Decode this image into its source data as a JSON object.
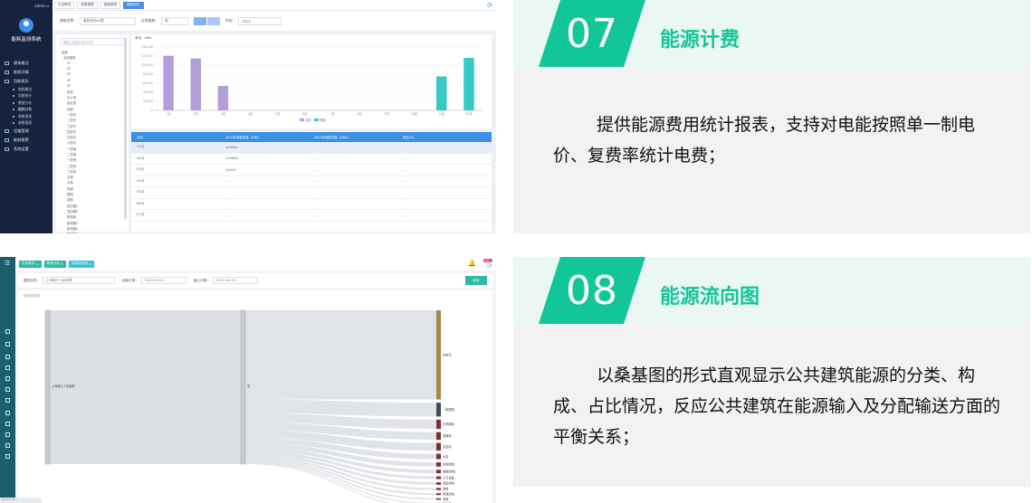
{
  "shot1": {
    "user_menu": "admin",
    "app_name": "能耗监测系统",
    "nav": [
      {
        "label": "建筑概况"
      },
      {
        "label": "能耗详情"
      },
      {
        "label": "用能报告",
        "sub": [
          "能耗概况",
          "用能统计",
          "数据分析",
          "能耗分析",
          "参数报表",
          "参数报表"
        ]
      },
      {
        "label": "设备管理"
      },
      {
        "label": "能耗报警"
      },
      {
        "label": "系统设置"
      }
    ],
    "tabs": [
      "平台概况",
      "参数报表",
      "能耗报表",
      "能耗分析"
    ],
    "filter": {
      "building_label": "建筑名称：",
      "building_value": "某科技办公楼",
      "type_label": "分类能耗：",
      "type_value": "电",
      "year_label": "年份：",
      "year_value": "2022"
    },
    "tree": {
      "search_placeholder": "请输入关键字进行过滤",
      "items": [
        "能耗",
        "全部建筑",
        "1F",
        "2F",
        "3F",
        "4F",
        "5F",
        "机房",
        "办公室",
        "会议室",
        "走廊",
        "一层东",
        "二层东",
        "三层东",
        "四层东",
        "五层东",
        "六层北",
        "一层南",
        "二层南",
        "一层西",
        "二层西",
        "三层西",
        "空调",
        "水泵",
        "电梯",
        "照明",
        "插座",
        "变压器1",
        "变压器2",
        "配电柜",
        "配电箱1",
        "配电箱2",
        "配电箱3"
      ]
    },
    "table": {
      "headers": [
        "月份",
        "2022年电能总量（kWh）",
        "2021年电能总量（kWh）",
        "同比(%)"
      ],
      "rows": [
        [
          "01月",
          "120632",
          "-",
          "-"
        ],
        [
          "02月",
          "114648",
          "-",
          "-"
        ],
        [
          "03月",
          "54014",
          "-",
          "-"
        ],
        [
          "04月",
          "-",
          "-",
          "-"
        ],
        [
          "05月",
          "-",
          "-",
          "-"
        ],
        [
          "06月",
          "-",
          "-",
          "-"
        ],
        [
          "07月",
          "-",
          "-",
          "-"
        ]
      ]
    }
  },
  "chart_data": {
    "type": "bar",
    "title": "",
    "ylabel": "单位：kWh",
    "categories": [
      "1月",
      "2月",
      "3月",
      "4月",
      "5月",
      "6月",
      "7月",
      "8月",
      "9月",
      "10月",
      "11月",
      "12月"
    ],
    "series": [
      {
        "name": "当期",
        "color": "#b39ddb",
        "values": [
          120632,
          114648,
          54014,
          0,
          0,
          0,
          0,
          0,
          0,
          0,
          0,
          0
        ]
      },
      {
        "name": "同期",
        "color": "#36c9c6",
        "values": [
          0,
          0,
          0,
          0,
          0,
          0,
          0,
          0,
          0,
          0,
          75000,
          116000
        ]
      }
    ],
    "ylim": [
      0,
      140000
    ],
    "yticks": [
      "0",
      "20,000",
      "40,000",
      "60,000",
      "80,000",
      "100,000",
      "120,000",
      "140,000"
    ],
    "legend": "bottom-center",
    "grid": true
  },
  "shot2": {
    "tabs": [
      "平台概况",
      "能耗分析",
      "能源流向图"
    ],
    "badge": "99+",
    "filter": {
      "building_label": "建筑名称：",
      "building_value": "上海某行人民医院",
      "start_label": "起始日期：",
      "start_value": "2022-04-01",
      "end_label": "截止日期：",
      "end_value": "2022-04-19",
      "query_label": "查询"
    },
    "sankey_title": "能源流向图",
    "sankey": {
      "source": "上海某行人民医院",
      "middle": "电",
      "targets": [
        "未命名",
        "一般照明",
        "分项能耗",
        "普通电",
        "应急电",
        "水泵",
        "空调用电",
        "电梯用电1",
        "工艺设备",
        "厨房用电",
        "其他",
        "特殊用电",
        "电梯",
        "雨水泵",
        "消防泵"
      ]
    },
    "status_text": "javascript:;"
  },
  "panel07": {
    "number": "07",
    "title": "能源计费",
    "body": "提供能源费用统计报表，支持对电能按照单一制电价、复费率统计电费；"
  },
  "panel08": {
    "number": "08",
    "title": "能源流向图",
    "body": "以桑基图的形式直观显示公共建筑能源的分类、构成、占比情况，反应公共建筑在能源输入及分配输送方面的平衡关系；"
  }
}
